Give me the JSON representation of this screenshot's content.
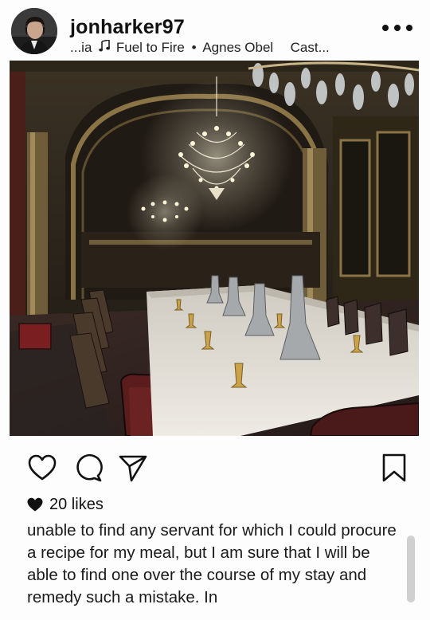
{
  "post": {
    "username": "jonharker97",
    "subtitle": {
      "text_before": "...ia",
      "song": "Fuel to Fire",
      "artist": "Agnes Obel",
      "trailing": "Cast..."
    },
    "photo_description": "Ornate dining hall with crystal chandeliers and long set table"
  },
  "icons": {
    "more": "more-horizontal-icon",
    "like": "heart-outline-icon",
    "comment": "comment-bubble-icon",
    "share": "paper-plane-icon",
    "save": "bookmark-icon",
    "likes": "heart-filled-icon",
    "music": "music-note-icon"
  },
  "engagement": {
    "likes_text": "20 likes"
  },
  "caption": {
    "text": "unable to find any servant for which I could procure a recipe for my meal, but I am sure that I will be able to find one over the course of my stay and remedy such a mistake. In"
  },
  "colors": {
    "text": "#1a1a1a",
    "background": "#fdfdfd",
    "scrollbar": "#d0d0d0"
  }
}
